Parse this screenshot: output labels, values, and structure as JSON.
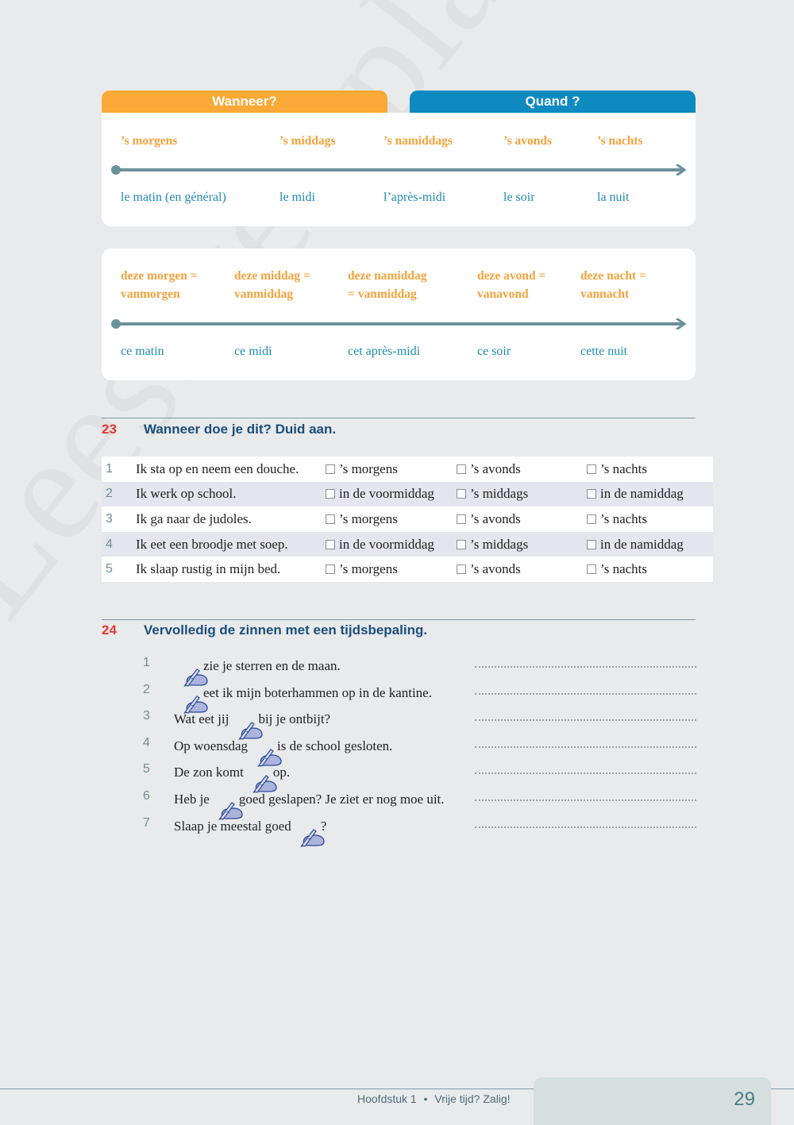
{
  "watermark": "Leesexemplaar",
  "colors": {
    "orange": "#f9a935",
    "blue": "#0f8ac0",
    "exercise_number": "#e63a2e",
    "exercise_title": "#1b4f7c",
    "timeline": "#6b9199"
  },
  "box1": {
    "tab_nl": "Wanneer?",
    "tab_fr": "Quand ?",
    "terms": [
      "’s morgens",
      "’s middags",
      "’s namiddags",
      "’s avonds",
      "’s nachts"
    ],
    "translations": [
      "le matin (en général)",
      "le midi",
      "l’après-midi",
      "le soir",
      "la nuit"
    ]
  },
  "box2": {
    "terms": [
      {
        "line1": "deze morgen =",
        "line2": "vanmorgen"
      },
      {
        "line1": "deze middag =",
        "line2": "vanmiddag"
      },
      {
        "line1": "deze namiddag",
        "line2": "= vanmiddag"
      },
      {
        "line1": "deze avond =",
        "line2": "vanavond"
      },
      {
        "line1": "deze nacht =",
        "line2": "vannacht"
      }
    ],
    "translations": [
      "ce matin",
      "ce midi",
      "cet après-midi",
      "ce soir",
      "cette nuit"
    ]
  },
  "exercise23": {
    "number": "23",
    "title": "Wanneer doe je dit? Duid aan.",
    "rows": [
      {
        "num": "1",
        "sentence": "Ik sta op en neem een douche.",
        "options": [
          "’s morgens",
          "’s avonds",
          "’s nachts"
        ]
      },
      {
        "num": "2",
        "sentence": "Ik werk op school.",
        "options": [
          "in de voormiddag",
          "’s middags",
          "in de namiddag"
        ]
      },
      {
        "num": "3",
        "sentence": "Ik ga naar de judoles.",
        "options": [
          "’s morgens",
          "’s avonds",
          "’s nachts"
        ]
      },
      {
        "num": "4",
        "sentence": "Ik eet een broodje met soep.",
        "options": [
          "in de voormiddag",
          "’s middags",
          "in de namiddag"
        ]
      },
      {
        "num": "5",
        "sentence": "Ik slaap rustig in mijn bed.",
        "options": [
          "’s morgens",
          "’s avonds",
          "’s nachts"
        ]
      }
    ]
  },
  "exercise24": {
    "number": "24",
    "title": "Vervolledig de zinnen met een tijdsbepaling.",
    "icon": "writing-hand-icon",
    "rows": [
      {
        "num": "1",
        "before": "",
        "after": "zie je sterren en de maan."
      },
      {
        "num": "2",
        "before": "",
        "after": "eet ik mijn boterhammen op in de kantine."
      },
      {
        "num": "3",
        "before": "Wat eet jij",
        "after": "bij je ontbijt?"
      },
      {
        "num": "4",
        "before": "Op woensdag",
        "after": "is de school gesloten."
      },
      {
        "num": "5",
        "before": "De zon komt",
        "after": "op."
      },
      {
        "num": "6",
        "before": "Heb je",
        "after": "goed geslapen? Je ziet er nog moe uit."
      },
      {
        "num": "7",
        "before": "Slaap je meestal goed",
        "after": "?"
      }
    ]
  },
  "footer": {
    "chapter": "Hoofdstuk 1",
    "separator": "•",
    "chapter_title": "Vrije tijd? Zalig!",
    "page_number": "29"
  }
}
